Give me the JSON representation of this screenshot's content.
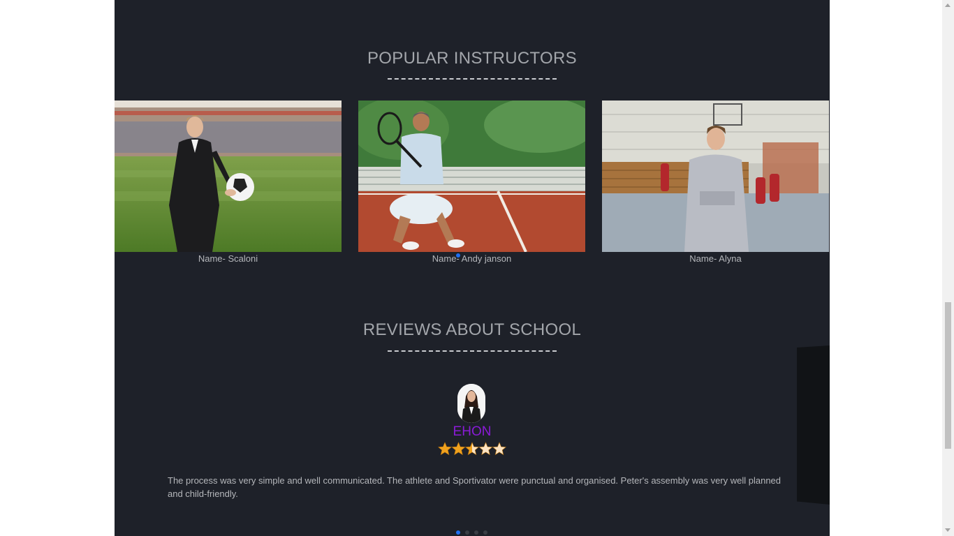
{
  "instructors_section": {
    "title": "POPULAR INSTRUCTORS",
    "instructors": [
      {
        "name": "Name- Scaloni"
      },
      {
        "name": "Name- Andy janson"
      },
      {
        "name": "Name- Alyna"
      }
    ]
  },
  "reviews_section": {
    "title": "REVIEWS ABOUT SCHOOL",
    "review": {
      "reviewer_name": "EHON",
      "rating": 2.5,
      "rating_max": 5,
      "text": "The process was very simple and well communicated. The athlete and Sportivator were punctual and organised. Peter's assembly was very well planned and child-friendly."
    },
    "pagination_count": 4,
    "active_page": 1
  },
  "colors": {
    "page_background": "#1e2129",
    "accent_blue": "#1f6ff2",
    "reviewer_name": "#8a1bd6",
    "star_fill": "#f0a21e"
  }
}
